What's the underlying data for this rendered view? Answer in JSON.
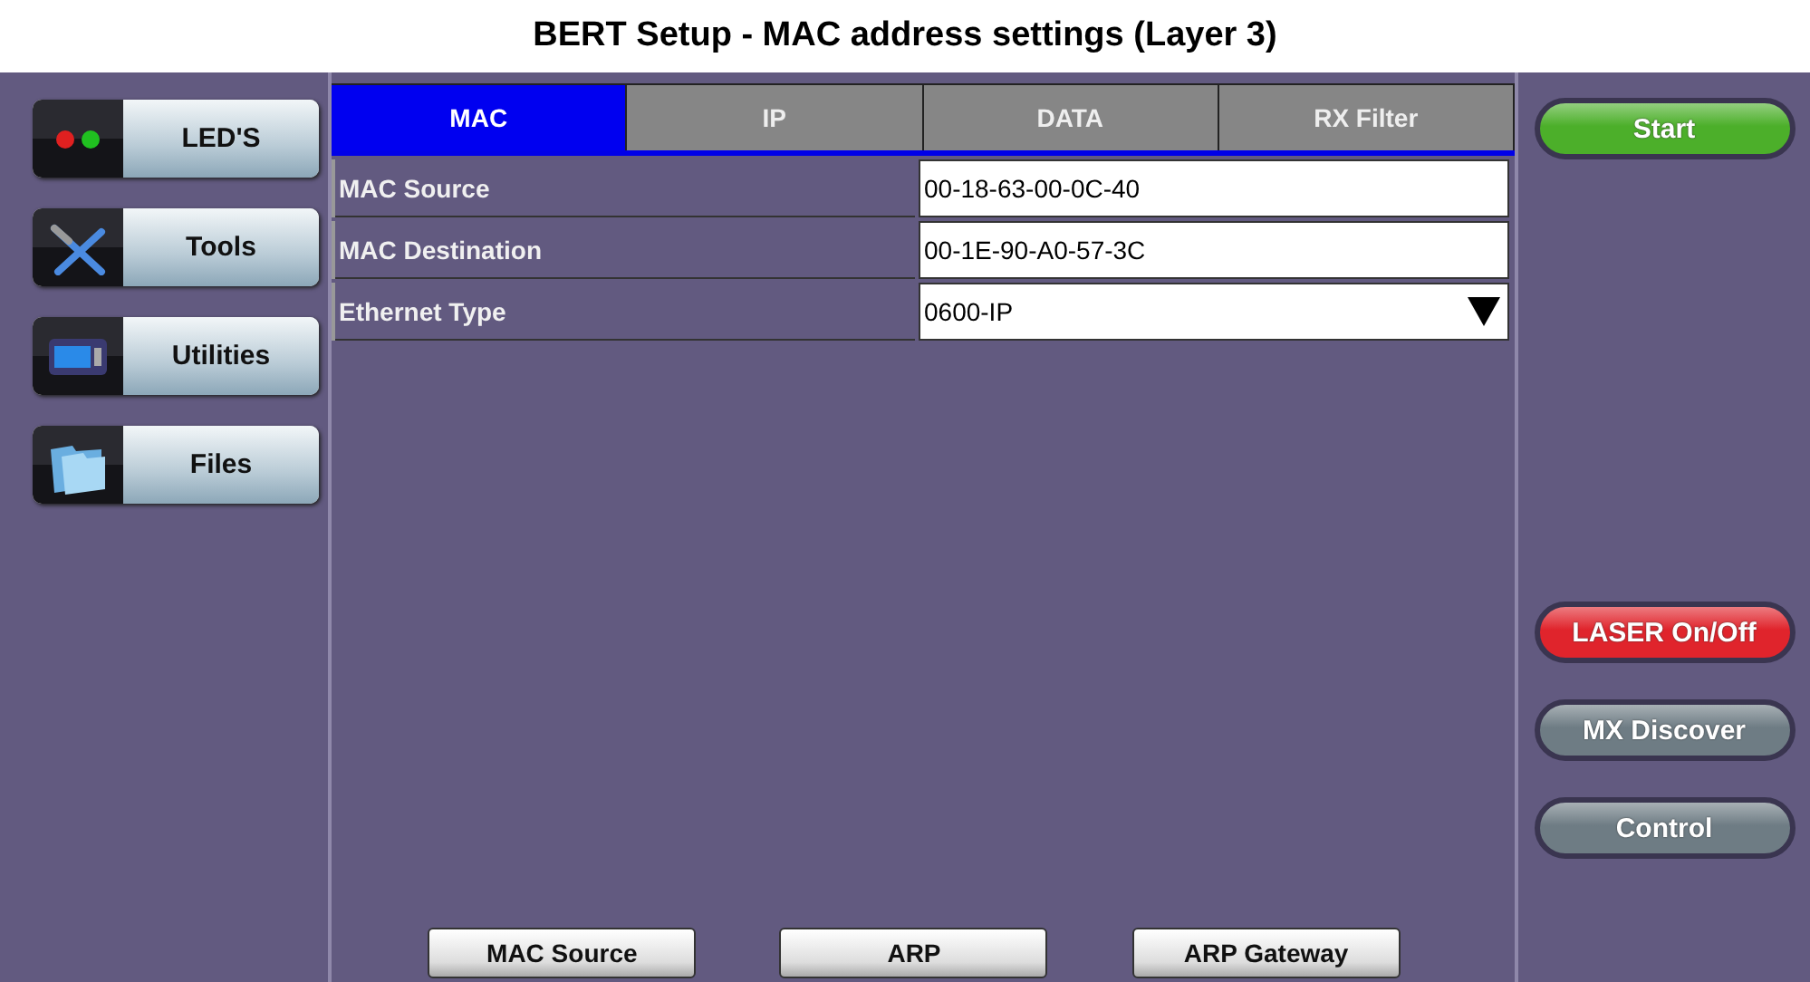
{
  "title": "BERT Setup - MAC address settings (Layer 3)",
  "sidebar": {
    "items": [
      {
        "label": "LED'S",
        "kind": "leds"
      },
      {
        "label": "Tools",
        "kind": "tools"
      },
      {
        "label": "Utilities",
        "kind": "utilities"
      },
      {
        "label": "Files",
        "kind": "files"
      }
    ]
  },
  "tabs": [
    {
      "label": "MAC",
      "selected": true
    },
    {
      "label": "IP",
      "selected": false
    },
    {
      "label": "DATA",
      "selected": false
    },
    {
      "label": "RX Filter",
      "selected": false
    }
  ],
  "fields": [
    {
      "label": "MAC Source",
      "value": "00-18-63-00-0C-40",
      "kind": "text"
    },
    {
      "label": "MAC Destination",
      "value": "00-1E-90-A0-57-3C",
      "kind": "text"
    },
    {
      "label": "Ethernet Type",
      "value": "0600-IP",
      "kind": "dropdown"
    }
  ],
  "bottom_buttons": [
    "MAC Source",
    "ARP",
    "ARP Gateway"
  ],
  "action_buttons": [
    {
      "label": "Start",
      "color": "#4caf2a"
    }
  ],
  "control_buttons": [
    {
      "label": "LASER On/Off",
      "color": "#e0242c"
    },
    {
      "label": "MX Discover",
      "color": "#6e7c84"
    },
    {
      "label": "Control",
      "color": "#6e7c84"
    }
  ]
}
